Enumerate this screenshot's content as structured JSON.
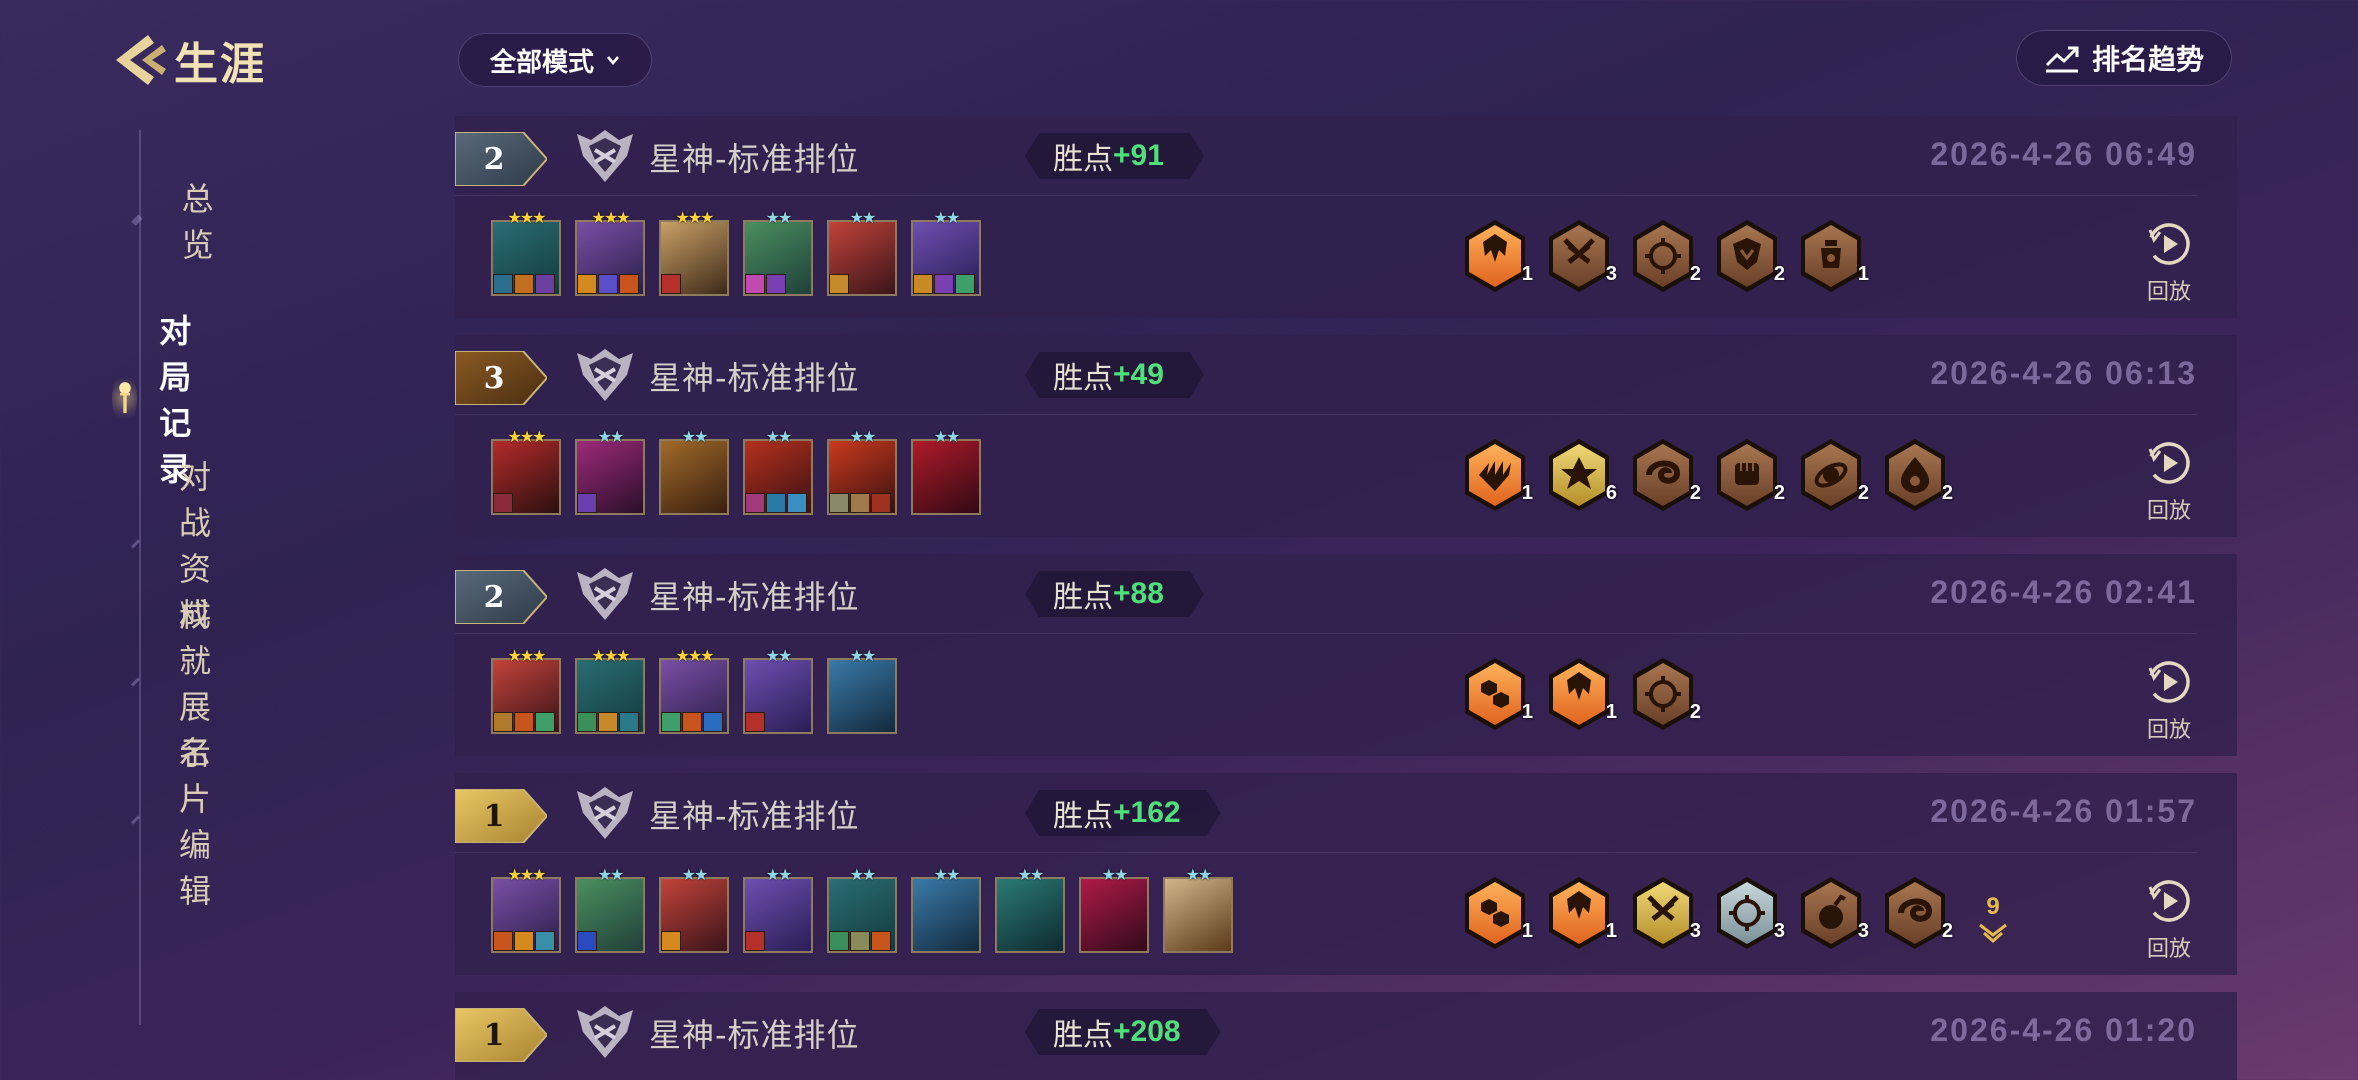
{
  "header": {
    "title": "生涯"
  },
  "nav": {
    "items": [
      {
        "label": "总览",
        "active": false
      },
      {
        "label": "对局记录",
        "active": true
      },
      {
        "label": "对战资料",
        "active": false
      },
      {
        "label": "成就展示",
        "active": false
      },
      {
        "label": "名片编辑",
        "active": false
      }
    ]
  },
  "filters": {
    "mode": "全部模式"
  },
  "trend": {
    "label": "排名趋势"
  },
  "common": {
    "points_label": "胜点",
    "replay_label": "回放"
  },
  "matches": [
    {
      "rank": "2",
      "rank_tier": "silver",
      "mode": "星神-标准排位",
      "points": "+91",
      "date": "2026-4-26   06:49",
      "champions": [
        {
          "stars": "★★★",
          "star_color": "#ffd23a",
          "colors": [
            "#2a6d74",
            "#133b3e"
          ],
          "items": [
            "#2a6d8c",
            "#c26f1f",
            "#6b3f9f"
          ]
        },
        {
          "stars": "★★★",
          "star_color": "#ffd23a",
          "colors": [
            "#7a4fa5",
            "#2a1f4a"
          ],
          "items": [
            "#d68a1e",
            "#5b4ec9",
            "#c9551e"
          ]
        },
        {
          "stars": "★★★",
          "star_color": "#ffd23a",
          "colors": [
            "#c9a066",
            "#3e2a19"
          ],
          "items": [
            "#b5302a"
          ]
        },
        {
          "stars": "★★",
          "star_color": "#8fd6e6",
          "colors": [
            "#4a8f5f",
            "#20403a"
          ],
          "items": [
            "#c04ab0",
            "#7a3fb0"
          ]
        },
        {
          "stars": "★★",
          "star_color": "#8fd6e6",
          "colors": [
            "#c2433a",
            "#3a141a"
          ],
          "items": [
            "#c78a2b"
          ]
        },
        {
          "stars": "★★",
          "star_color": "#8fd6e6",
          "colors": [
            "#6d4fb0",
            "#2b1d55"
          ],
          "items": [
            "#c98a25",
            "#7a3fb0",
            "#3f9f6a"
          ]
        }
      ],
      "traits": [
        {
          "tier": "orange",
          "icon": "brawler-icon",
          "count": "1"
        },
        {
          "tier": "bronze",
          "icon": "crossed-blades-icon",
          "count": "3"
        },
        {
          "tier": "bronze",
          "icon": "crosshair-icon",
          "count": "2"
        },
        {
          "tier": "bronze",
          "icon": "shield-icon",
          "count": "2"
        },
        {
          "tier": "bronze",
          "icon": "lantern-icon",
          "count": "1"
        }
      ],
      "more": null
    },
    {
      "rank": "3",
      "rank_tier": "bronze",
      "mode": "星神-标准排位",
      "points": "+49",
      "date": "2026-4-26   06:13",
      "champions": [
        {
          "stars": "★★★",
          "star_color": "#ffd23a",
          "colors": [
            "#b52a2a",
            "#2a1010"
          ],
          "items": [
            "#8a2a3a"
          ]
        },
        {
          "stars": "★★",
          "star_color": "#8fd6e6",
          "colors": [
            "#9d2a7a",
            "#2a0f2a"
          ],
          "items": [
            "#6b3fb0"
          ]
        },
        {
          "stars": "★★",
          "star_color": "#8fd6e6",
          "colors": [
            "#a06a2a",
            "#3a1f10"
          ],
          "items": []
        },
        {
          "stars": "★★",
          "star_color": "#8fd6e6",
          "colors": [
            "#b5301e",
            "#3a1212"
          ],
          "items": [
            "#a03a7a",
            "#2a7aa8",
            "#3a8fc0"
          ]
        },
        {
          "stars": "★★",
          "star_color": "#8fd6e6",
          "colors": [
            "#c93a1e",
            "#3a1010"
          ],
          "items": [
            "#8a8a6a",
            "#a07a4a",
            "#a03020"
          ]
        },
        {
          "stars": "★★",
          "star_color": "#8fd6e6",
          "colors": [
            "#b01a2a",
            "#300a14"
          ],
          "items": []
        }
      ],
      "traits": [
        {
          "tier": "orange",
          "icon": "splash-icon",
          "count": "1"
        },
        {
          "tier": "gold",
          "icon": "flower-icon",
          "count": "6"
        },
        {
          "tier": "bronze",
          "icon": "swirl-icon",
          "count": "2"
        },
        {
          "tier": "bronze",
          "icon": "fist-icon",
          "count": "2"
        },
        {
          "tier": "bronze",
          "icon": "orbit-icon",
          "count": "2"
        },
        {
          "tier": "bronze",
          "icon": "droplet-icon",
          "count": "2"
        }
      ],
      "more": null
    },
    {
      "rank": "2",
      "rank_tier": "silver",
      "mode": "星神-标准排位",
      "points": "+88",
      "date": "2026-4-26   02:41",
      "champions": [
        {
          "stars": "★★★",
          "star_color": "#ffd23a",
          "colors": [
            "#c2433a",
            "#3a141a"
          ],
          "items": [
            "#b07a2a",
            "#c9551e",
            "#3f9f6a"
          ]
        },
        {
          "stars": "★★★",
          "star_color": "#ffd23a",
          "colors": [
            "#2a6d74",
            "#133b3e"
          ],
          "items": [
            "#3a8f5a",
            "#c78a2b",
            "#2a7a8c"
          ]
        },
        {
          "stars": "★★★",
          "star_color": "#ffd23a",
          "colors": [
            "#7a4fa5",
            "#2a1f4a"
          ],
          "items": [
            "#3f9f6a",
            "#c9551e",
            "#2a6dc0"
          ]
        },
        {
          "stars": "★★",
          "star_color": "#8fd6e6",
          "colors": [
            "#6d4fb0",
            "#2b1d55"
          ],
          "items": [
            "#b5302a"
          ]
        },
        {
          "stars": "★★",
          "star_color": "#8fd6e6",
          "colors": [
            "#3a7aa8",
            "#132a3e"
          ],
          "items": []
        }
      ],
      "traits": [
        {
          "tier": "orange",
          "icon": "hexagons-icon",
          "count": "1"
        },
        {
          "tier": "orange",
          "icon": "brawler-icon",
          "count": "1"
        },
        {
          "tier": "bronze",
          "icon": "crosshair-icon",
          "count": "2"
        }
      ],
      "more": null
    },
    {
      "rank": "1",
      "rank_tier": "gold",
      "mode": "星神-标准排位",
      "points": "+162",
      "date": "2026-4-26   01:57",
      "champions": [
        {
          "stars": "★★★",
          "star_color": "#ffd23a",
          "colors": [
            "#7a4fa5",
            "#2a1f4a"
          ],
          "items": [
            "#c9551e",
            "#d68a1e",
            "#3a8fa8"
          ]
        },
        {
          "stars": "★★",
          "star_color": "#8fd6e6",
          "colors": [
            "#4a8f5f",
            "#20403a"
          ],
          "items": [
            "#2a4ac0"
          ]
        },
        {
          "stars": "★★",
          "star_color": "#8fd6e6",
          "colors": [
            "#c2433a",
            "#3a141a"
          ],
          "items": [
            "#d68a1e"
          ]
        },
        {
          "stars": "★★",
          "star_color": "#8fd6e6",
          "colors": [
            "#6d4fb0",
            "#2b1d55"
          ],
          "items": [
            "#b5302a"
          ]
        },
        {
          "stars": "★★",
          "star_color": "#8fd6e6",
          "colors": [
            "#2a6d74",
            "#133b3e"
          ],
          "items": [
            "#3a8f5a",
            "#8a8a5a",
            "#c9551e"
          ]
        },
        {
          "stars": "★★",
          "star_color": "#8fd6e6",
          "colors": [
            "#3a7aa8",
            "#132a3e"
          ],
          "items": []
        },
        {
          "stars": "★★",
          "star_color": "#8fd6e6",
          "colors": [
            "#2a7a74",
            "#0f2a30"
          ],
          "items": []
        },
        {
          "stars": "★★",
          "star_color": "#8fd6e6",
          "colors": [
            "#b01a4a",
            "#300a1a"
          ],
          "items": []
        },
        {
          "stars": "★★",
          "star_color": "#8fd6e6",
          "colors": [
            "#d2b68a",
            "#5a3a1a"
          ],
          "items": []
        }
      ],
      "traits": [
        {
          "tier": "orange",
          "icon": "hexagons-icon",
          "count": "1"
        },
        {
          "tier": "orange",
          "icon": "brawler-icon",
          "count": "1"
        },
        {
          "tier": "gold",
          "icon": "crossed-blades-icon",
          "count": "3"
        },
        {
          "tier": "silver",
          "icon": "crosshair-icon",
          "count": "3"
        },
        {
          "tier": "bronze",
          "icon": "bomb-icon",
          "count": "3"
        },
        {
          "tier": "bronze",
          "icon": "swirl-icon",
          "count": "2"
        }
      ],
      "more": "9"
    },
    {
      "rank": "1",
      "rank_tier": "gold",
      "mode": "星神-标准排位",
      "points": "+208",
      "date": "2026-4-26   01:20",
      "champions": [],
      "traits": [],
      "more": null
    }
  ],
  "colors": {
    "accent_gold": "#f1e3b4",
    "points_green": "#4fe07a",
    "trait_orange": "#f08a2a",
    "trait_gold": "#d8b84a",
    "trait_bronze": "#8a5a3a",
    "trait_silver": "#9ab0b8"
  }
}
